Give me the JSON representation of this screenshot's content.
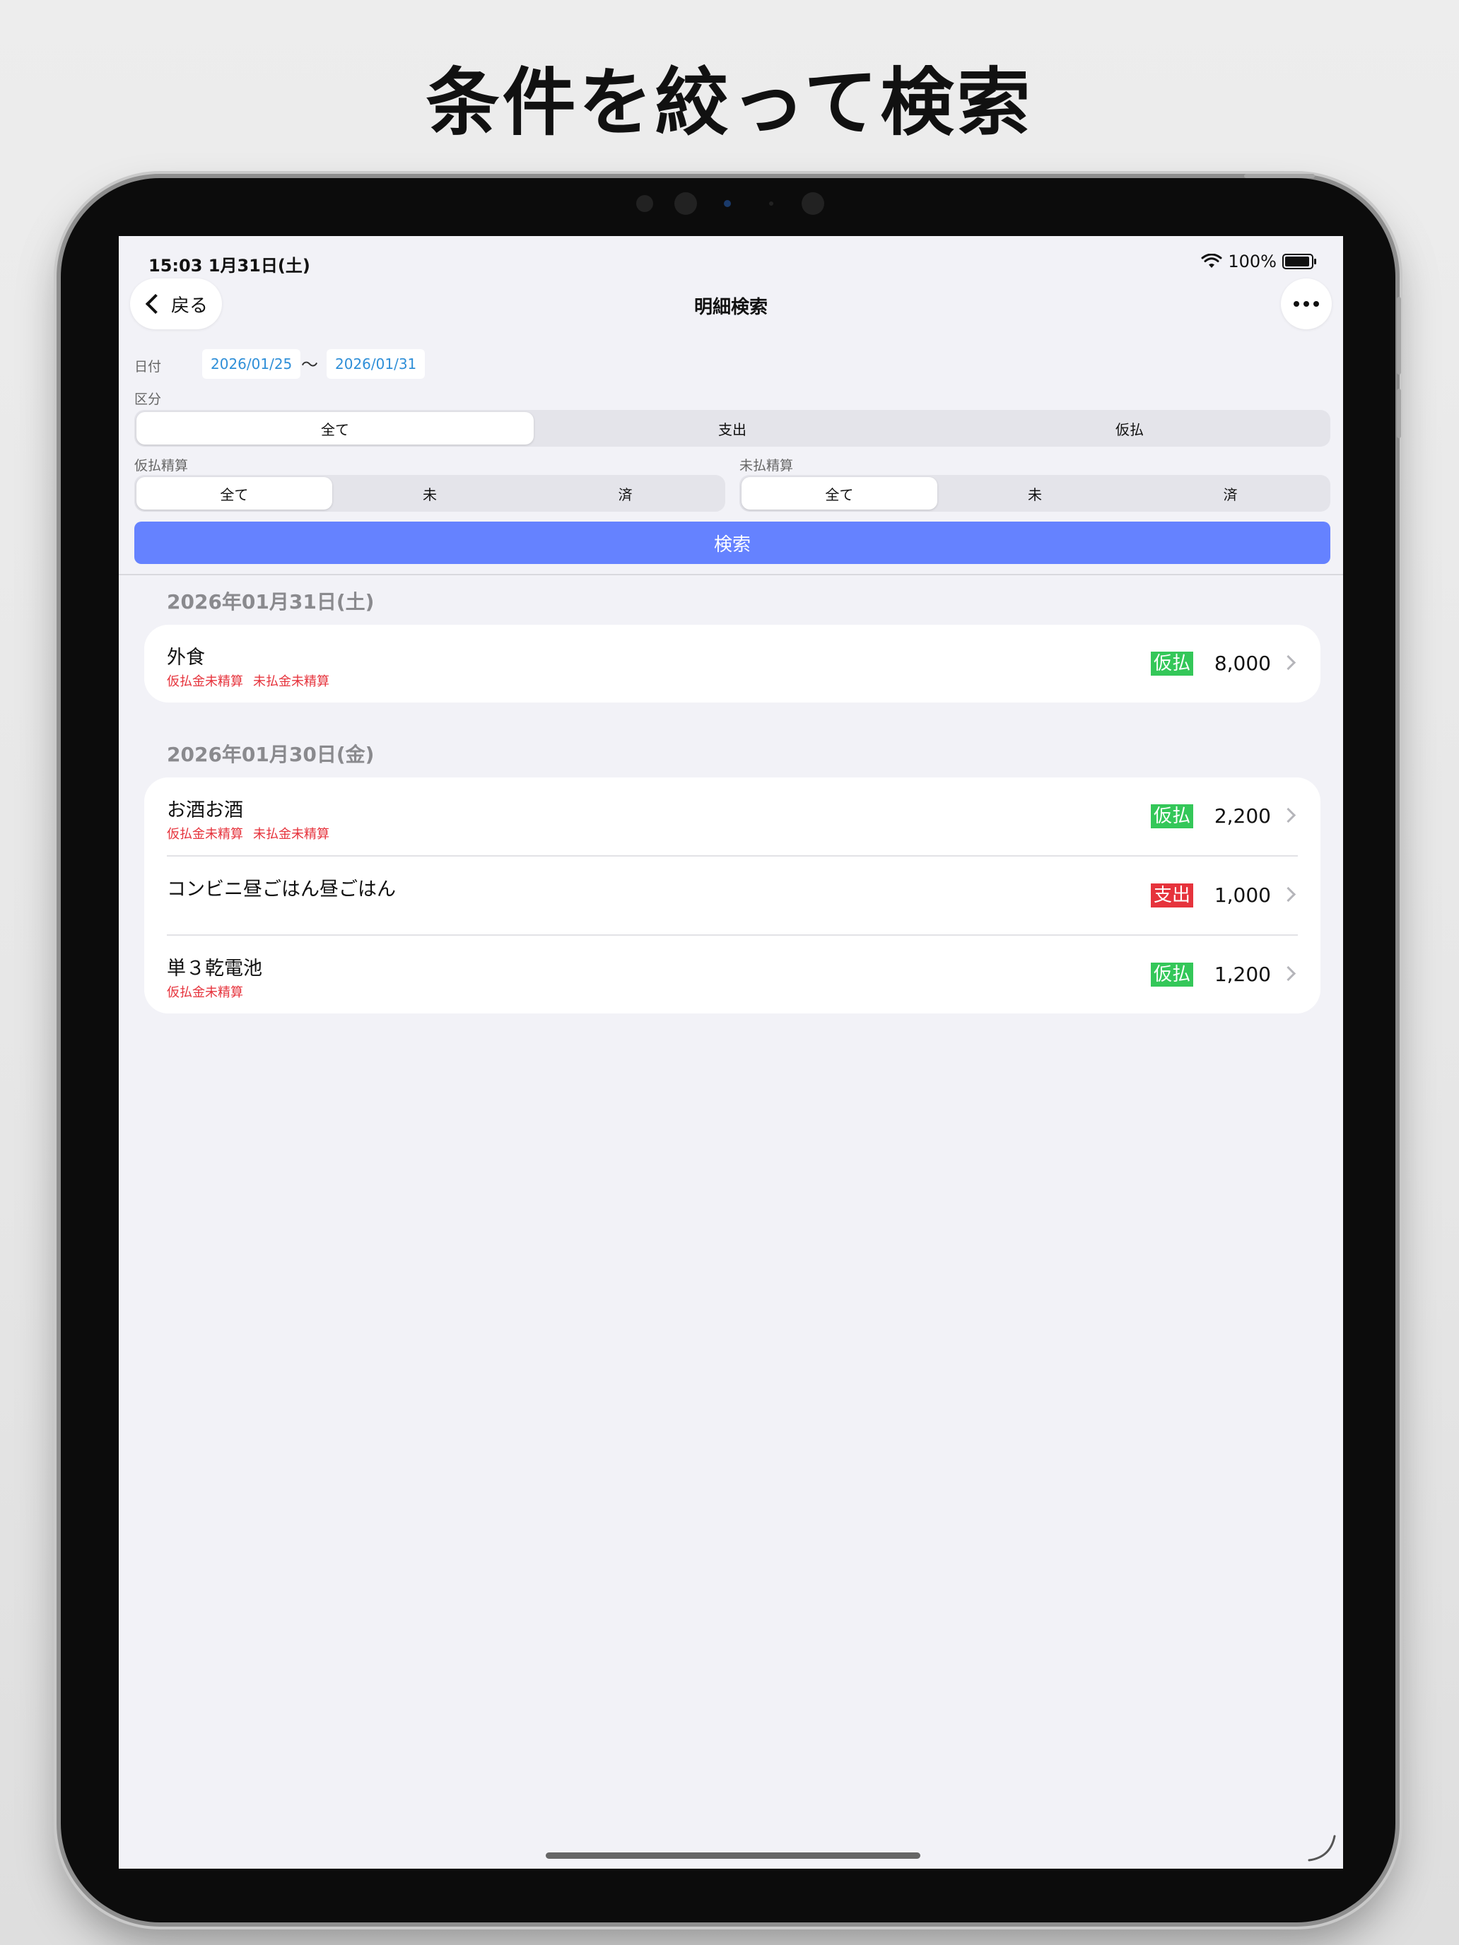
{
  "headline": "条件を絞って検索",
  "status": {
    "time": "15:03  1月31日(土)",
    "battery": "100%"
  },
  "nav": {
    "back_label": "戻る",
    "title": "明細検索"
  },
  "filters": {
    "date_label": "日付",
    "date_from": "2026/01/25",
    "date_sep": "〜",
    "date_to": "2026/01/31",
    "kubun_label": "区分",
    "kubun_options": [
      "全て",
      "支出",
      "仮払"
    ],
    "kubun_selected": 0,
    "karibarai_label": "仮払精算",
    "karibarai_options": [
      "全て",
      "未",
      "済"
    ],
    "karibarai_selected": 0,
    "mibarai_label": "未払精算",
    "mibarai_options": [
      "全て",
      "未",
      "済"
    ],
    "mibarai_selected": 0,
    "search_label": "検索"
  },
  "groups": [
    {
      "date": "2026年01月31日(土)",
      "items": [
        {
          "title": "外食",
          "notes": [
            "仮払金未精算",
            "未払金未精算"
          ],
          "badge": "仮払",
          "badge_color": "#34c759",
          "amount": "8,000"
        }
      ]
    },
    {
      "date": "2026年01月30日(金)",
      "items": [
        {
          "title": "お酒お酒",
          "notes": [
            "仮払金未精算",
            "未払金未精算"
          ],
          "badge": "仮払",
          "badge_color": "#34c759",
          "amount": "2,200"
        },
        {
          "title": "コンビニ昼ごはん昼ごはん",
          "notes": [],
          "badge": "支出",
          "badge_color": "#e6333c",
          "amount": "1,000"
        },
        {
          "title": "単３乾電池",
          "notes": [
            "仮払金未精算"
          ],
          "badge": "仮払",
          "badge_color": "#34c759",
          "amount": "1,200"
        }
      ]
    }
  ],
  "colors": {
    "accent": "#6582ff",
    "date_text": "#2f8fd8",
    "warning": "#e6333c"
  }
}
